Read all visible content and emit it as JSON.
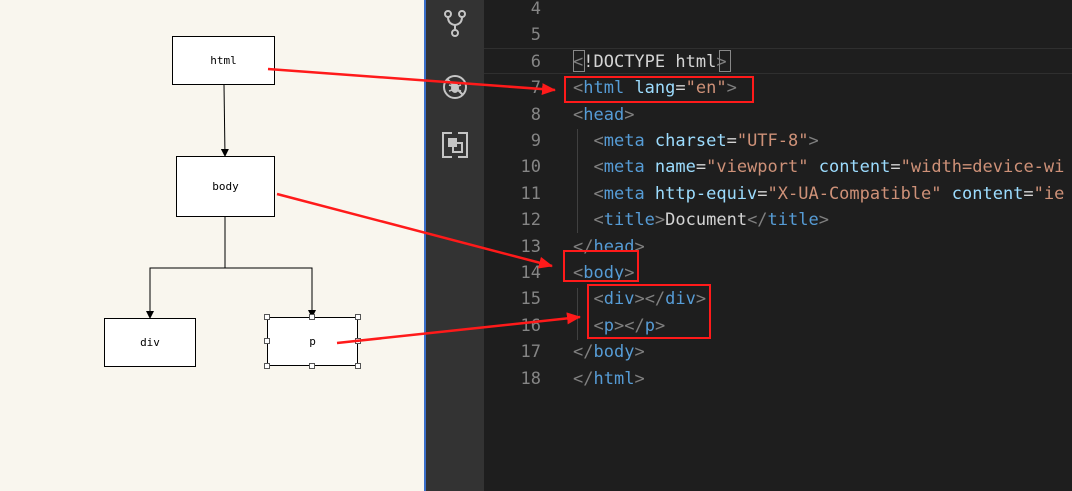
{
  "diagram": {
    "nodes": {
      "html": "html",
      "body": "body",
      "div": "div",
      "p": "p"
    }
  },
  "sidebar_icons": [
    "source-control-icon",
    "debug-icon",
    "extensions-icon"
  ],
  "editor": {
    "lines": [
      {
        "num": "4",
        "tokens": []
      },
      {
        "num": "5",
        "tokens": []
      },
      {
        "num": "6",
        "tokens": [
          {
            "t": "<",
            "c": "punc"
          },
          {
            "t": "!DOCTYPE html",
            "c": "txt"
          },
          {
            "t": ">",
            "c": "punc"
          }
        ]
      },
      {
        "num": "7",
        "tokens": [
          {
            "t": "<",
            "c": "punc"
          },
          {
            "t": "html",
            "c": "tag"
          },
          {
            "t": " lang",
            "c": "attr"
          },
          {
            "t": "=",
            "c": "txt"
          },
          {
            "t": "\"en\"",
            "c": "str"
          },
          {
            "t": ">",
            "c": "punc"
          }
        ]
      },
      {
        "num": "8",
        "tokens": [
          {
            "t": "<",
            "c": "punc"
          },
          {
            "t": "head",
            "c": "tag"
          },
          {
            "t": ">",
            "c": "punc"
          }
        ]
      },
      {
        "num": "9",
        "tokens": [
          {
            "t": "  ",
            "c": "txt"
          },
          {
            "t": "<",
            "c": "punc"
          },
          {
            "t": "meta",
            "c": "tag"
          },
          {
            "t": " charset",
            "c": "attr"
          },
          {
            "t": "=",
            "c": "txt"
          },
          {
            "t": "\"UTF-8\"",
            "c": "str"
          },
          {
            "t": ">",
            "c": "punc"
          }
        ]
      },
      {
        "num": "10",
        "tokens": [
          {
            "t": "  ",
            "c": "txt"
          },
          {
            "t": "<",
            "c": "punc"
          },
          {
            "t": "meta",
            "c": "tag"
          },
          {
            "t": " name",
            "c": "attr"
          },
          {
            "t": "=",
            "c": "txt"
          },
          {
            "t": "\"viewport\"",
            "c": "str"
          },
          {
            "t": " content",
            "c": "attr"
          },
          {
            "t": "=",
            "c": "txt"
          },
          {
            "t": "\"width=device-wi",
            "c": "str"
          }
        ]
      },
      {
        "num": "11",
        "tokens": [
          {
            "t": "  ",
            "c": "txt"
          },
          {
            "t": "<",
            "c": "punc"
          },
          {
            "t": "meta",
            "c": "tag"
          },
          {
            "t": " http-equiv",
            "c": "attr"
          },
          {
            "t": "=",
            "c": "txt"
          },
          {
            "t": "\"X-UA-Compatible\"",
            "c": "str"
          },
          {
            "t": " content",
            "c": "attr"
          },
          {
            "t": "=",
            "c": "txt"
          },
          {
            "t": "\"ie",
            "c": "str"
          }
        ]
      },
      {
        "num": "12",
        "tokens": [
          {
            "t": "  ",
            "c": "txt"
          },
          {
            "t": "<",
            "c": "punc"
          },
          {
            "t": "title",
            "c": "tag"
          },
          {
            "t": ">",
            "c": "punc"
          },
          {
            "t": "Document",
            "c": "txt"
          },
          {
            "t": "</",
            "c": "punc"
          },
          {
            "t": "title",
            "c": "tag"
          },
          {
            "t": ">",
            "c": "punc"
          }
        ]
      },
      {
        "num": "13",
        "tokens": [
          {
            "t": "</",
            "c": "punc"
          },
          {
            "t": "head",
            "c": "tag"
          },
          {
            "t": ">",
            "c": "punc"
          }
        ]
      },
      {
        "num": "14",
        "tokens": [
          {
            "t": "<",
            "c": "punc"
          },
          {
            "t": "body",
            "c": "tag"
          },
          {
            "t": ">",
            "c": "punc"
          }
        ]
      },
      {
        "num": "15",
        "tokens": [
          {
            "t": "  ",
            "c": "txt"
          },
          {
            "t": "<",
            "c": "punc"
          },
          {
            "t": "div",
            "c": "tag"
          },
          {
            "t": "></",
            "c": "punc"
          },
          {
            "t": "div",
            "c": "tag"
          },
          {
            "t": ">",
            "c": "punc"
          }
        ]
      },
      {
        "num": "16",
        "tokens": [
          {
            "t": "  ",
            "c": "txt"
          },
          {
            "t": "<",
            "c": "punc"
          },
          {
            "t": "p",
            "c": "tag"
          },
          {
            "t": "></",
            "c": "punc"
          },
          {
            "t": "p",
            "c": "tag"
          },
          {
            "t": ">",
            "c": "punc"
          }
        ]
      },
      {
        "num": "17",
        "tokens": [
          {
            "t": "</",
            "c": "punc"
          },
          {
            "t": "body",
            "c": "tag"
          },
          {
            "t": ">",
            "c": "punc"
          }
        ]
      },
      {
        "num": "18",
        "tokens": [
          {
            "t": "</",
            "c": "punc"
          },
          {
            "t": "html",
            "c": "tag"
          },
          {
            "t": ">",
            "c": "punc"
          }
        ]
      }
    ]
  },
  "colors": {
    "annotation": "#ff1a1a",
    "tag": "#569cd6",
    "attribute": "#9cdcfe",
    "string": "#ce9178",
    "punctuation": "#808080",
    "line_number": "#858585"
  }
}
